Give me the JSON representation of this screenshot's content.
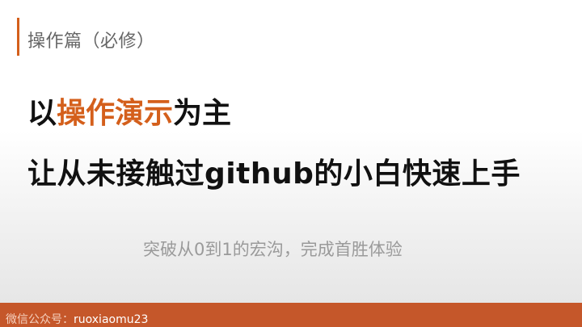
{
  "section": {
    "title": "操作篇（必修）"
  },
  "headline": {
    "line1_pre": "以",
    "line1_accent": "操作演示",
    "line1_post": "为主",
    "line2": "让从未接触过github的小白快速上手"
  },
  "subtitle": "突破从0到1的宏沟，完成首胜体验",
  "footer": {
    "label": "微信公众号：",
    "account": "ruoxiaomu23"
  },
  "colors": {
    "accent": "#d45f1b",
    "footer_bg": "#c5572a"
  }
}
